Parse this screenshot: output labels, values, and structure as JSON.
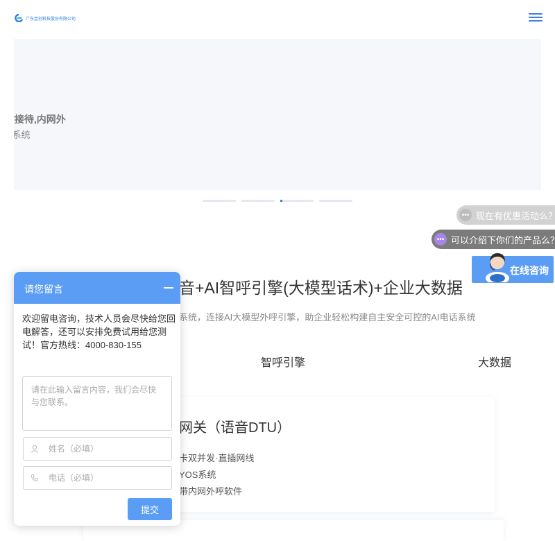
{
  "header": {
    "logo_text": "广东金创科技股份有限公司",
    "menu_icon": "hamburger-icon",
    "brand_color": "#3d7ee0"
  },
  "banner": {
    "line1": "/接待,内网外",
    "line2": ":系统",
    "slide_count": 4,
    "active_slide": 3
  },
  "float": {
    "question1": "现在有优惠活动么？",
    "question2": "可以介绍下你们的产品么？",
    "online_label": "在线咨询"
  },
  "main": {
    "title": "音+AI智呼引擎(大模型话术)+企业大数据",
    "subtitle": "系统，连接AI大模型外呼引擎，助企业轻松构建自主安全可控的AI电话系统",
    "tabs": [
      {
        "label": "智呼引擎"
      },
      {
        "label": "大数据"
      }
    ],
    "card": {
      "title": "网关（语音DTU）",
      "items": [
        "卡双并发·直插网线",
        "YOS系统",
        "带内网外呼软件"
      ]
    }
  },
  "message": {
    "title": "请您留言",
    "intro": "欢迎留电咨询，技术人员会尽快给您回电解答，还可以安排免费试用给您测试！官方热线：4000-830-155",
    "content_placeholder": "请在此输入留言内容，我们会尽快与您联系。",
    "name_placeholder": "姓名（必填）",
    "phone_placeholder": "电话（必填）",
    "submit_label": "提交",
    "accent_color": "#5b9df5"
  }
}
